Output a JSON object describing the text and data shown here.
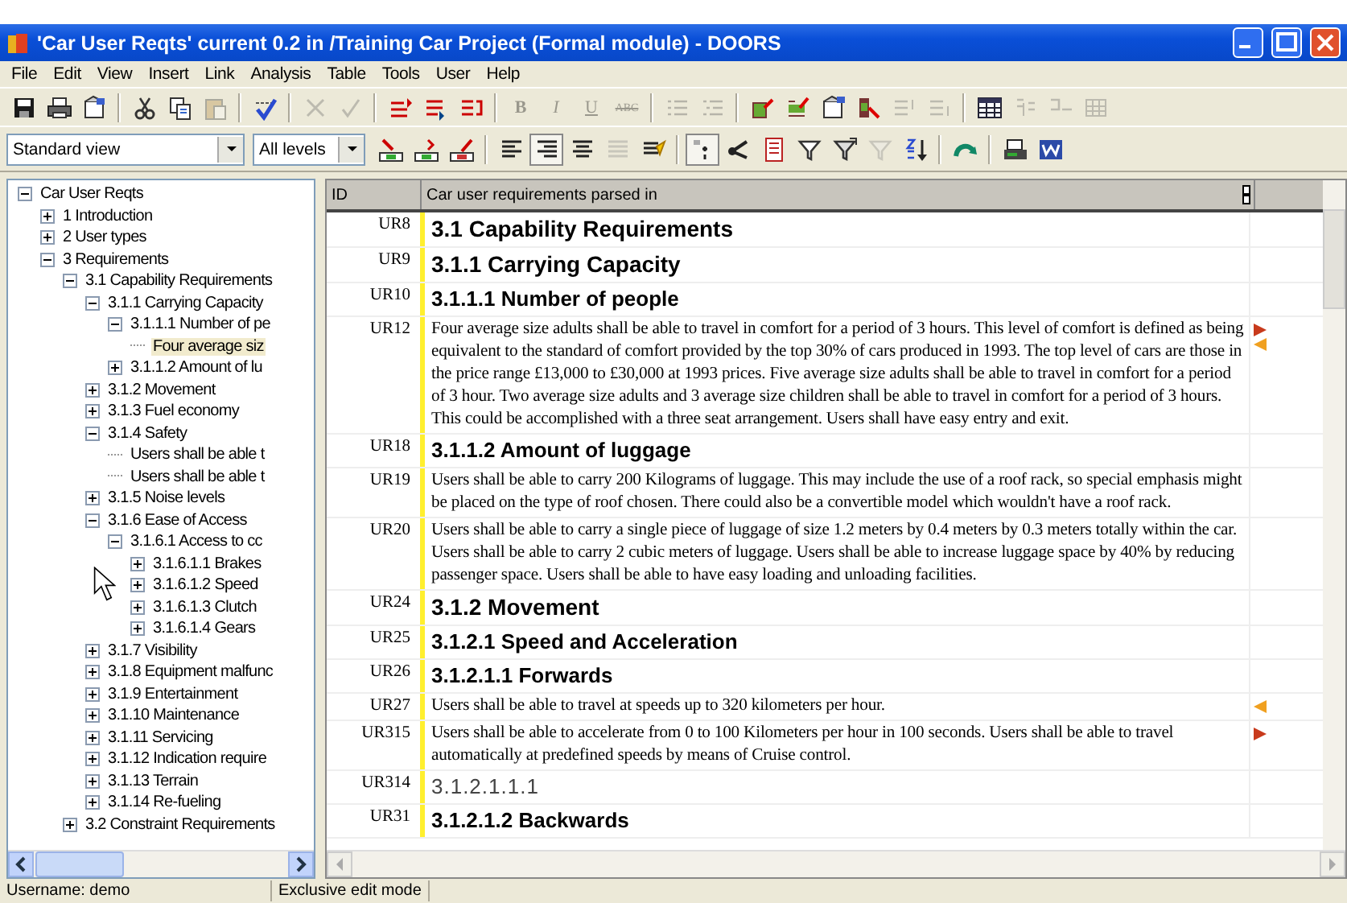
{
  "window": {
    "title": "'Car User Reqts' current 0.2 in /Training Car Project (Formal module) - DOORS"
  },
  "menu": [
    {
      "label": "File"
    },
    {
      "label": "Edit"
    },
    {
      "label": "View"
    },
    {
      "label": "Insert"
    },
    {
      "label": "Link"
    },
    {
      "label": "Analysis"
    },
    {
      "label": "Table"
    },
    {
      "label": "Tools"
    },
    {
      "label": "User"
    },
    {
      "label": "Help"
    }
  ],
  "toolbar": [
    {
      "kind": "icon",
      "disabled": false
    },
    {
      "kind": "icon",
      "disabled": false
    },
    {
      "kind": "icon",
      "disabled": false
    },
    {
      "kind": "separator"
    },
    {
      "kind": "icon",
      "disabled": false
    },
    {
      "kind": "icon",
      "disabled": false
    },
    {
      "kind": "icon",
      "disabled": true
    },
    {
      "kind": "separator"
    },
    {
      "kind": "icon",
      "disabled": false
    },
    {
      "kind": "separator"
    },
    {
      "kind": "icon",
      "disabled": true
    },
    {
      "kind": "icon",
      "disabled": true
    },
    {
      "kind": "separator"
    },
    {
      "kind": "icon",
      "disabled": false
    },
    {
      "kind": "icon",
      "disabled": false
    },
    {
      "kind": "icon",
      "disabled": false
    },
    {
      "kind": "separator"
    },
    {
      "kind": "glyph",
      "label": "B",
      "disabled": true
    },
    {
      "kind": "glyph",
      "label": "I",
      "disabled": true
    },
    {
      "kind": "glyph",
      "label": "U",
      "disabled": true
    },
    {
      "kind": "glyph",
      "label": "ABC",
      "disabled": true
    },
    {
      "kind": "separator"
    },
    {
      "kind": "icon",
      "disabled": true
    },
    {
      "kind": "icon",
      "disabled": true
    },
    {
      "kind": "separator"
    },
    {
      "kind": "icon",
      "disabled": false
    },
    {
      "kind": "icon",
      "disabled": false
    },
    {
      "kind": "icon",
      "disabled": false
    },
    {
      "kind": "icon",
      "disabled": false
    },
    {
      "kind": "icon",
      "disabled": true
    },
    {
      "kind": "icon",
      "disabled": true
    },
    {
      "kind": "separator"
    },
    {
      "kind": "icon",
      "disabled": false
    },
    {
      "kind": "icon",
      "disabled": true
    },
    {
      "kind": "icon",
      "disabled": true
    },
    {
      "kind": "icon",
      "disabled": true
    }
  ],
  "toolbar2": [
    {
      "kind": "select",
      "value": "Standard view"
    },
    {
      "kind": "select",
      "value": "All levels"
    },
    {
      "kind": "icon",
      "disabled": false,
      "pressed": false
    },
    {
      "kind": "icon",
      "disabled": false,
      "pressed": false
    },
    {
      "kind": "icon",
      "disabled": false,
      "pressed": false
    },
    {
      "kind": "separator"
    },
    {
      "kind": "icon",
      "disabled": false,
      "pressed": false
    },
    {
      "kind": "icon",
      "disabled": false,
      "pressed": true
    },
    {
      "kind": "icon",
      "disabled": false,
      "pressed": false
    },
    {
      "kind": "icon",
      "disabled": true,
      "pressed": false
    },
    {
      "kind": "icon",
      "disabled": false,
      "pressed": false
    },
    {
      "kind": "separator"
    },
    {
      "kind": "icon",
      "disabled": false,
      "pressed": true
    },
    {
      "kind": "icon",
      "disabled": false,
      "pressed": false
    },
    {
      "kind": "icon",
      "disabled": false,
      "pressed": false
    },
    {
      "kind": "icon",
      "disabled": false,
      "pressed": false
    },
    {
      "kind": "icon",
      "disabled": false,
      "pressed": false
    },
    {
      "kind": "icon",
      "disabled": true,
      "pressed": false
    },
    {
      "kind": "icon",
      "disabled": false,
      "pressed": false
    },
    {
      "kind": "separator"
    },
    {
      "kind": "icon",
      "disabled": false,
      "pressed": false
    },
    {
      "kind": "separator"
    },
    {
      "kind": "icon",
      "disabled": false,
      "pressed": false
    },
    {
      "kind": "icon",
      "disabled": false,
      "pressed": false
    }
  ],
  "tree": [
    {
      "label": "Car User Reqts",
      "expanded": true,
      "selected": false,
      "children": [
        {
          "label": "1 Introduction",
          "expanded": false,
          "selected": false
        },
        {
          "label": "2 User types",
          "expanded": false,
          "selected": false
        },
        {
          "label": "3 Requirements",
          "expanded": true,
          "selected": false,
          "children": [
            {
              "label": "3.1 Capability Requirements",
              "expanded": true,
              "selected": false,
              "children": [
                {
                  "label": "3.1.1 Carrying Capacity",
                  "expanded": true,
                  "selected": false,
                  "children": [
                    {
                      "label": "3.1.1.1 Number of pe",
                      "expanded": true,
                      "selected": false,
                      "children": [
                        {
                          "label": "Four average siz",
                          "selected": true
                        }
                      ]
                    },
                    {
                      "label": "3.1.1.2 Amount of lu",
                      "expanded": false,
                      "selected": false
                    }
                  ]
                },
                {
                  "label": "3.1.2 Movement",
                  "expanded": false,
                  "selected": false
                },
                {
                  "label": "3.1.3 Fuel economy",
                  "expanded": false,
                  "selected": false
                },
                {
                  "label": "3.1.4 Safety",
                  "expanded": true,
                  "selected": false,
                  "children": [
                    {
                      "label": "Users shall be able t",
                      "selected": false
                    },
                    {
                      "label": "Users shall be able t",
                      "selected": false
                    }
                  ]
                },
                {
                  "label": "3.1.5 Noise levels",
                  "expanded": false,
                  "selected": false
                },
                {
                  "label": "3.1.6 Ease of Access",
                  "expanded": true,
                  "selected": false,
                  "children": [
                    {
                      "label": "3.1.6.1 Access to cc",
                      "expanded": true,
                      "selected": false,
                      "children": [
                        {
                          "label": "3.1.6.1.1 Brakes",
                          "expanded": false,
                          "selected": false
                        },
                        {
                          "label": "3.1.6.1.2 Speed",
                          "expanded": false,
                          "selected": false
                        },
                        {
                          "label": "3.1.6.1.3 Clutch",
                          "expanded": false,
                          "selected": false
                        },
                        {
                          "label": "3.1.6.1.4 Gears",
                          "expanded": false,
                          "selected": false
                        }
                      ]
                    }
                  ]
                },
                {
                  "label": "3.1.7 Visibility",
                  "expanded": false,
                  "selected": false
                },
                {
                  "label": "3.1.8 Equipment malfunc",
                  "expanded": false,
                  "selected": false
                },
                {
                  "label": "3.1.9 Entertainment",
                  "expanded": false,
                  "selected": false
                },
                {
                  "label": "3.1.10 Maintenance",
                  "expanded": false,
                  "selected": false
                },
                {
                  "label": "3.1.11 Servicing",
                  "expanded": false,
                  "selected": false
                },
                {
                  "label": "3.1.12 Indication require",
                  "expanded": false,
                  "selected": false
                },
                {
                  "label": "3.1.13 Terrain",
                  "expanded": false,
                  "selected": false
                },
                {
                  "label": "3.1.14 Re-fueling",
                  "expanded": false,
                  "selected": false
                }
              ]
            },
            {
              "label": "3.2 Constraint Requirements",
              "expanded": false,
              "selected": false
            }
          ]
        }
      ]
    }
  ],
  "table": {
    "columns": [
      "ID",
      "Car user requirements parsed in"
    ],
    "rows": [
      {
        "id": "UR8",
        "kind": "heading1",
        "text": "3.1 Capability Requirements"
      },
      {
        "id": "UR9",
        "kind": "heading1",
        "text": "3.1.1 Carrying Capacity"
      },
      {
        "id": "UR10",
        "kind": "heading2",
        "text": "3.1.1.1 Number of people"
      },
      {
        "id": "UR12",
        "kind": "text",
        "text": "Four average size adults shall be able to travel in comfort for a period of 3 hours. This level of comfort is defined as being equivalent to the standard of comfort provided by the top 30% of cars produced in 1993. The top level of cars are those in the price range £13,000  to £30,000 at 1993 prices. Five average size adults shall be able to travel in comfort for a period of 3 hour. Two average size adults and 3 average size children shall be able to travel in comfort for a period of 3 hours. This could be accomplished with a three seat arrangement. Users shall have easy entry and exit.",
        "outgoing_link": true,
        "incoming_link": true
      },
      {
        "id": "UR18",
        "kind": "heading2",
        "text": "3.1.1.2 Amount of luggage"
      },
      {
        "id": "UR19",
        "kind": "text",
        "text": "Users shall be able to carry 200 Kilograms of luggage. This may include the use of a roof rack, so special emphasis might be placed on the type of roof chosen. There could also be a convertible model which wouldn't have a roof rack."
      },
      {
        "id": "UR20",
        "kind": "text",
        "text": "Users shall be able to carry a single piece of luggage of size 1.2 meters by 0.4 meters by 0.3 meters totally within the car. Users shall be able to carry 2 cubic meters of luggage. Users shall be able to increase luggage space by 40% by reducing passenger space. Users shall be able to have easy loading and unloading facilities."
      },
      {
        "id": "UR24",
        "kind": "heading1",
        "text": "3.1.2 Movement"
      },
      {
        "id": "UR25",
        "kind": "heading2",
        "text": "3.1.2.1 Speed and Acceleration"
      },
      {
        "id": "UR26",
        "kind": "heading2",
        "text": "3.1.2.1.1 Forwards"
      },
      {
        "id": "UR27",
        "kind": "text",
        "text": "Users shall be able to travel at speeds up to 320 kilometers per hour.",
        "outgoing_link": false,
        "incoming_link": true
      },
      {
        "id": "UR315",
        "kind": "text",
        "text": "Users shall be able to accelerate from 0 to 100 Kilometers per hour in 100 seconds. Users shall be able to travel automatically at predefined speeds by means of Cruise control.",
        "outgoing_link": true,
        "incoming_link": false
      },
      {
        "id": "UR314",
        "kind": "number",
        "text": "3.1.2.1.1.1"
      },
      {
        "id": "UR31",
        "kind": "heading2",
        "text": "3.1.2.1.2 Backwards"
      }
    ]
  },
  "status_bar": [
    {
      "text": "Username: demo"
    },
    {
      "text": "Exclusive edit mode"
    }
  ]
}
